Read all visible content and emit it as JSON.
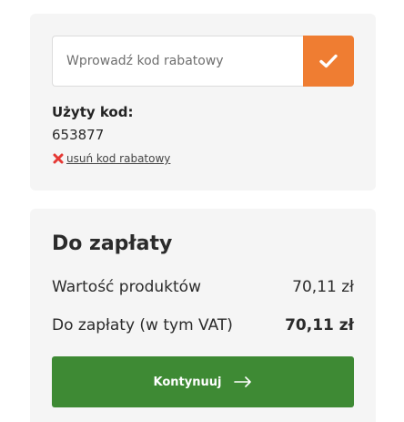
{
  "discount": {
    "input_placeholder": "Wprowadź kod rabatowy",
    "input_value": "",
    "apply_button_icon": "checkmark-icon",
    "used_code_label": "Użyty kod:",
    "used_code_value": "653877",
    "remove_icon": "red-x-icon",
    "remove_link_label": " usuń kod rabatowy"
  },
  "summary": {
    "title": "Do zapłaty",
    "rows": [
      {
        "label": "Wartość produktów",
        "value": "70,11 zł"
      },
      {
        "label": "Do zapłaty (w tym VAT)",
        "value": "70,11 zł"
      }
    ],
    "continue_label": "Kontynuuj",
    "continue_icon": "arrow-right-icon"
  },
  "colors": {
    "accent_orange": "#ef7d32",
    "primary_green": "#3e8a34",
    "remove_red": "#e53935",
    "card_background": "#f5f5f5"
  }
}
